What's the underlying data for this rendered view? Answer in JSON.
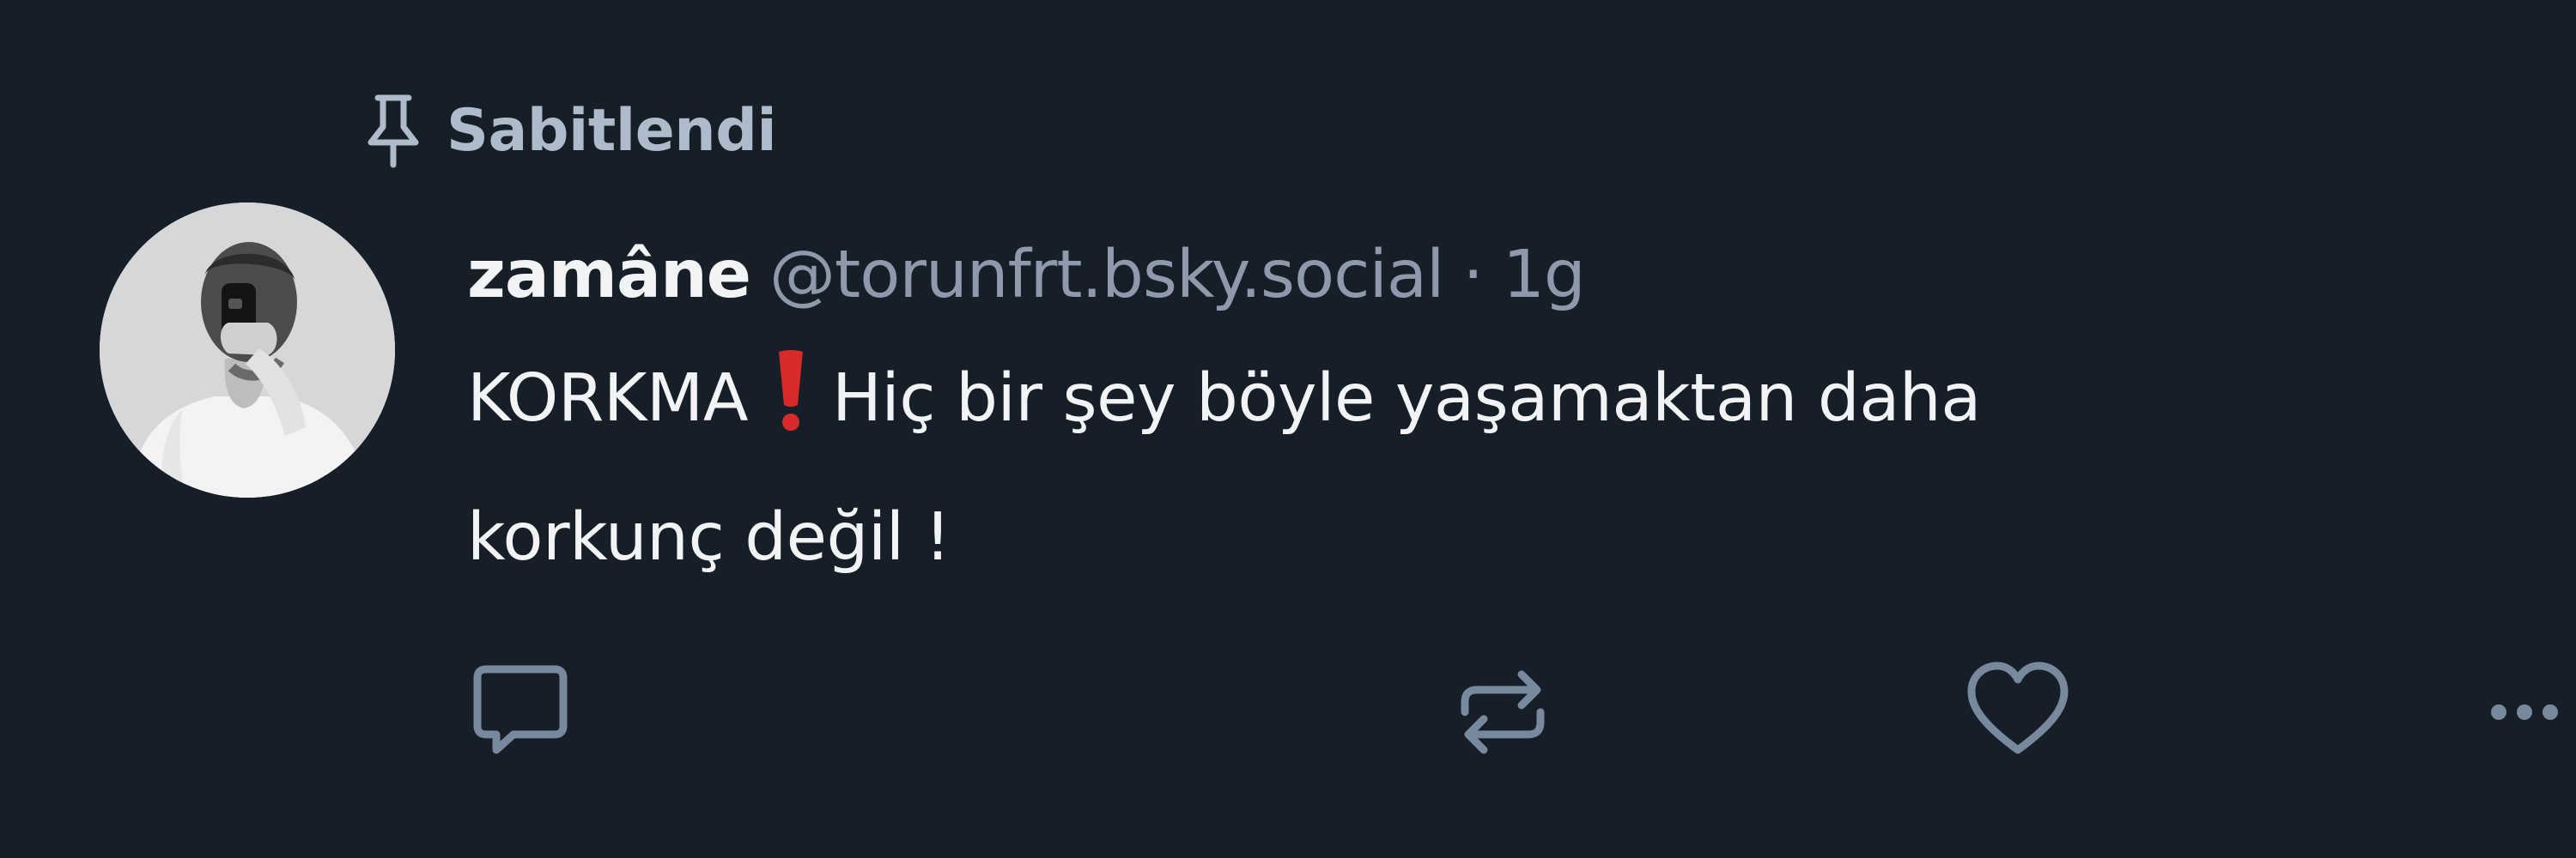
{
  "pinned": {
    "label": "Sabitlendi",
    "icon": "pin-icon"
  },
  "author": {
    "display_name": "zamâne",
    "handle": "@torunfrt.bsky.social",
    "separator": "·",
    "time": "1g",
    "avatar_icon": "avatar-photo"
  },
  "post": {
    "text_part1": "KORKMA",
    "emoji": "❗",
    "text_part2": "Hiç bir şey böyle yaşamaktan daha\nkorkunç değil !"
  },
  "actions": [
    {
      "icon": "reply-icon"
    },
    {
      "icon": "repost-icon"
    },
    {
      "icon": "like-icon"
    },
    {
      "icon": "more-icon"
    }
  ],
  "colors": {
    "background": "#161e27",
    "primary_text": "#f1f3f5",
    "secondary_text": "#8e9aab",
    "pinned_text": "#aebbca",
    "icon": "#78889d",
    "emoji_red": "#d82a2a"
  }
}
